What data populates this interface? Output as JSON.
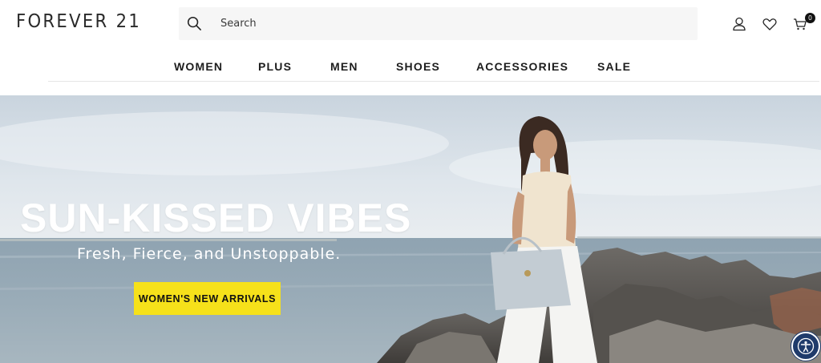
{
  "brand": {
    "logo_text": "FOREVER 21"
  },
  "search": {
    "placeholder": "Search"
  },
  "header_icons": {
    "account": "user-icon",
    "wishlist": "heart-icon",
    "cart": "cart-icon",
    "cart_count": "0"
  },
  "nav": {
    "items": [
      {
        "label": "WOMEN"
      },
      {
        "label": "PLUS"
      },
      {
        "label": "MEN"
      },
      {
        "label": "SHOES"
      },
      {
        "label": "ACCESSORIES"
      },
      {
        "label": "SALE"
      }
    ]
  },
  "hero": {
    "title": "SUN-KISSED VIBES",
    "subtitle": "Fresh, Fierce, and Unstoppable.",
    "cta_label": "WOMEN'S NEW ARRIVALS"
  },
  "accessibility": {
    "icon": "accessibility-icon"
  },
  "colors": {
    "cta": "#f6e11a",
    "accessibility_button": "#1f3b6b",
    "text_dark": "#1d1d1d"
  }
}
